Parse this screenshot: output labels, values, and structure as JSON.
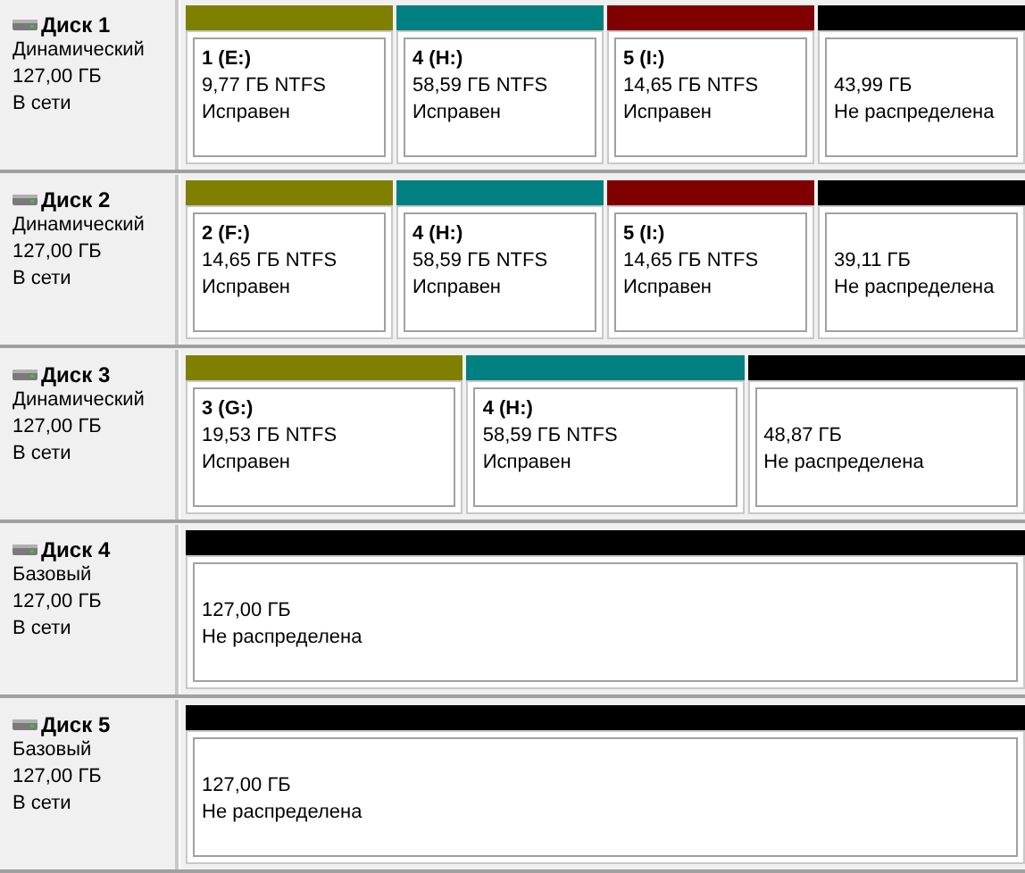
{
  "disks": [
    {
      "name": "Диск 1",
      "type": "Динамический",
      "size": "127,00 ГБ",
      "status": "В сети",
      "partitions": [
        {
          "kind": "volume",
          "color": "#808000",
          "title": "1  (E:)",
          "size": "9,77 ГБ NTFS",
          "status": "Исправен"
        },
        {
          "kind": "volume",
          "color": "#008080",
          "title": "4  (H:)",
          "size": "58,59 ГБ NTFS",
          "status": "Исправен"
        },
        {
          "kind": "volume",
          "color": "#800000",
          "title": "5  (I:)",
          "size": "14,65 ГБ NTFS",
          "status": "Исправен"
        },
        {
          "kind": "unallocated",
          "color": "#000000",
          "size": "43,99 ГБ",
          "status": "Не распределена"
        }
      ]
    },
    {
      "name": "Диск 2",
      "type": "Динамический",
      "size": "127,00 ГБ",
      "status": "В сети",
      "partitions": [
        {
          "kind": "volume",
          "color": "#808000",
          "title": "2  (F:)",
          "size": "14,65 ГБ NTFS",
          "status": "Исправен"
        },
        {
          "kind": "volume",
          "color": "#008080",
          "title": "4  (H:)",
          "size": "58,59 ГБ NTFS",
          "status": "Исправен"
        },
        {
          "kind": "volume",
          "color": "#800000",
          "title": "5  (I:)",
          "size": "14,65 ГБ NTFS",
          "status": "Исправен"
        },
        {
          "kind": "unallocated",
          "color": "#000000",
          "size": "39,11 ГБ",
          "status": "Не распределена"
        }
      ]
    },
    {
      "name": "Диск 3",
      "type": "Динамический",
      "size": "127,00 ГБ",
      "status": "В сети",
      "partitions": [
        {
          "kind": "volume",
          "color": "#808000",
          "title": "3  (G:)",
          "size": "19,53 ГБ NTFS",
          "status": "Исправен"
        },
        {
          "kind": "volume",
          "color": "#008080",
          "title": "4  (H:)",
          "size": "58,59 ГБ NTFS",
          "status": "Исправен"
        },
        {
          "kind": "unallocated",
          "color": "#000000",
          "size": "48,87 ГБ",
          "status": "Не распределена"
        }
      ]
    },
    {
      "name": "Диск 4",
      "type": "Базовый",
      "size": "127,00 ГБ",
      "status": "В сети",
      "partitions": [
        {
          "kind": "unallocated",
          "color": "#000000",
          "size": "127,00 ГБ",
          "status": "Не распределена"
        }
      ]
    },
    {
      "name": "Диск 5",
      "type": "Базовый",
      "size": "127,00 ГБ",
      "status": "В сети",
      "partitions": [
        {
          "kind": "unallocated",
          "color": "#000000",
          "size": "127,00 ГБ",
          "status": "Не распределена"
        }
      ]
    }
  ]
}
